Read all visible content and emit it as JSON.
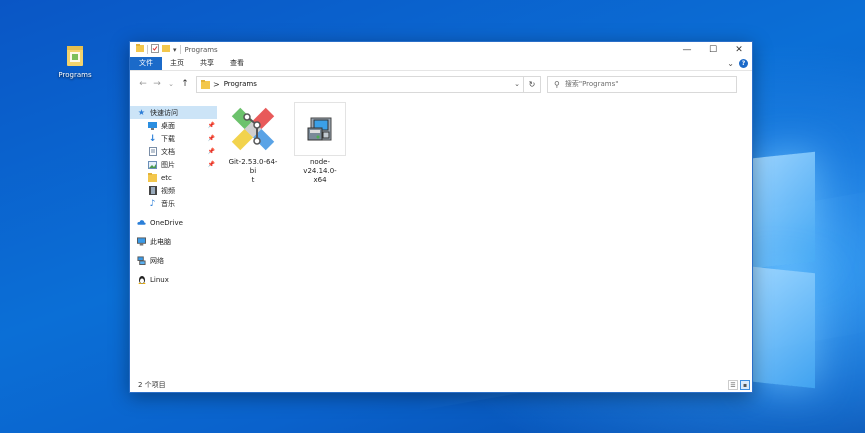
{
  "desktop": {
    "icons": [
      {
        "label": "Programs",
        "icon": "folder-icon"
      }
    ]
  },
  "window": {
    "title": "Programs",
    "controls": {
      "minimize": "—",
      "maximize": "☐",
      "close": "✕"
    }
  },
  "ribbon": {
    "tabs": [
      "文件",
      "主页",
      "共享",
      "查看"
    ],
    "expand_glyph": "⌄",
    "help_glyph": "?"
  },
  "address_bar": {
    "path": "Programs",
    "separator": ">",
    "dropdown": "⌄",
    "refresh": "↻"
  },
  "search": {
    "placeholder": "搜索\"Programs\""
  },
  "sidebar": {
    "quick_access": {
      "label": "快速访问",
      "icon": "star-icon"
    },
    "pinned": [
      {
        "label": "桌面",
        "icon": "desktop-icon",
        "pinned": true
      },
      {
        "label": "下载",
        "icon": "download-icon",
        "pinned": true
      },
      {
        "label": "文档",
        "icon": "document-icon",
        "pinned": true
      },
      {
        "label": "图片",
        "icon": "pictures-icon",
        "pinned": true
      },
      {
        "label": "etc",
        "icon": "folder-icon",
        "pinned": false
      },
      {
        "label": "视频",
        "icon": "video-icon",
        "pinned": false
      },
      {
        "label": "音乐",
        "icon": "music-icon",
        "pinned": false
      }
    ],
    "roots": [
      {
        "label": "OneDrive",
        "icon": "cloud-icon"
      },
      {
        "label": "此电脑",
        "icon": "computer-icon"
      },
      {
        "label": "网络",
        "icon": "network-icon"
      },
      {
        "label": "Linux",
        "icon": "linux-icon"
      }
    ]
  },
  "files": [
    {
      "name_line1": "Git-2.53.0-64-bi",
      "name_line2": "t",
      "icon": "git-installer-icon"
    },
    {
      "name_line1": "node-v24.14.0-",
      "name_line2": "x64",
      "icon": "msi-installer-icon"
    }
  ],
  "status": {
    "item_count": "2 个项目"
  },
  "colors": {
    "accent": "#1b6ac9",
    "selection": "#cce4f7"
  }
}
